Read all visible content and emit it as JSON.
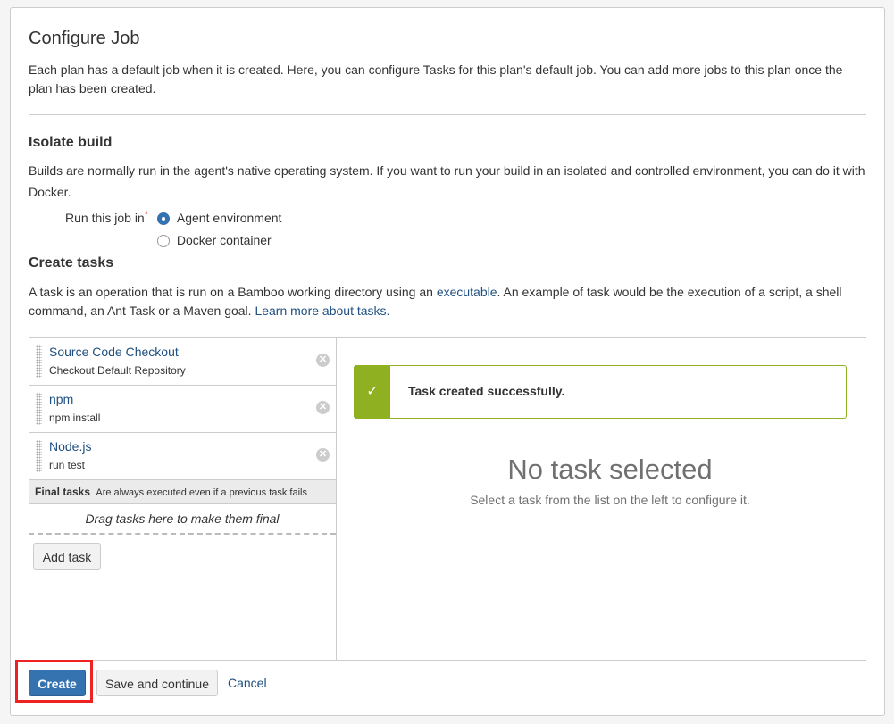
{
  "header": {
    "title": "Configure Job",
    "description": "Each plan has a default job when it is created. Here, you can configure Tasks for this plan's default job. You can add more jobs to this plan once the plan has been created."
  },
  "isolate": {
    "title": "Isolate build",
    "description": "Builds are normally run in the agent's native operating system. If you want to run your build in an isolated and controlled environment, you can do it with Docker.",
    "run_label": "Run this job in",
    "required_mark": "*",
    "options": [
      {
        "label": "Agent environment",
        "selected": true
      },
      {
        "label": "Docker container",
        "selected": false
      }
    ]
  },
  "create_tasks": {
    "title": "Create tasks",
    "desc_part1": "A task is an operation that is run on a Bamboo working directory using an ",
    "desc_link1": "executable",
    "desc_part2": ". An example of task would be the execution of a script, a shell command, an Ant Task or a Maven goal. ",
    "desc_link2": "Learn more about tasks."
  },
  "tasks": [
    {
      "name": "Source Code Checkout",
      "description": "Checkout Default Repository"
    },
    {
      "name": "npm",
      "description": "npm install"
    },
    {
      "name": "Node.js",
      "description": "run test"
    }
  ],
  "final_tasks": {
    "label": "Final tasks",
    "note": "Are always executed even if a previous task fails",
    "drop_hint": "Drag tasks here to make them final"
  },
  "add_task_label": "Add task",
  "success": {
    "icon": "check-icon",
    "message": "Task created successfully."
  },
  "empty_state": {
    "title": "No task selected",
    "subtitle": "Select a task from the list on the left to configure it."
  },
  "footer": {
    "create_label": "Create",
    "save_label": "Save and continue",
    "cancel_label": "Cancel"
  },
  "colors": {
    "primary": "#3572b0",
    "link": "#205081",
    "success": "#8eb021",
    "highlight": "#ee2222"
  }
}
